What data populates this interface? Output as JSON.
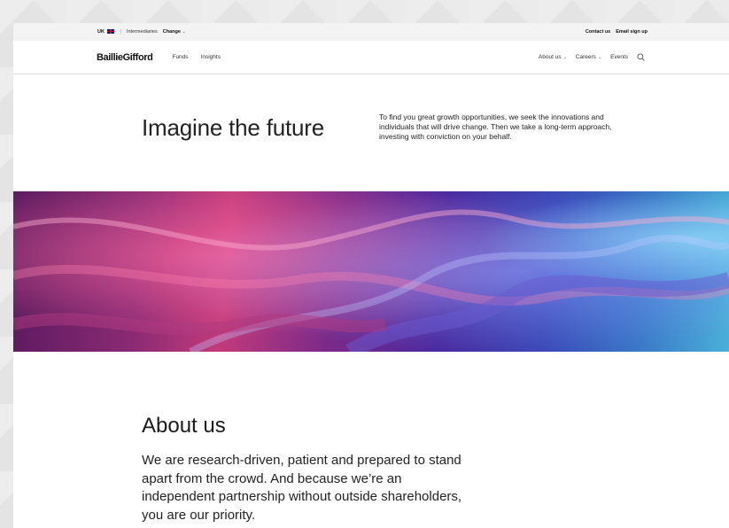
{
  "utility_bar": {
    "region": "UK",
    "region_flag_icon": "uk-flag-icon",
    "separator": "|",
    "audience": "Intermediaries",
    "change_label": "Change",
    "change_icon": "chevron-down-icon",
    "contact_label": "Contact us",
    "email_signup_label": "Email sign up"
  },
  "nav": {
    "logo": "BaillieGifford",
    "left_links": [
      "Funds",
      "Insights"
    ],
    "about_label": "About us",
    "careers_label": "Careers",
    "events_label": "Events",
    "search_icon": "search-icon"
  },
  "hero": {
    "title": "Imagine the future",
    "text": "To find you great growth opportunities, we seek the innovations and individuals that will drive change. Then we take a long-term approach, investing with conviction on your behalf."
  },
  "banner": {
    "description_icon": "abstract-particle-wave-image",
    "colors": [
      "#5a1a5e",
      "#c23a7a",
      "#4a2aa0",
      "#4ab0d8"
    ]
  },
  "about": {
    "heading": "About us",
    "body": "We are research-driven, patient and prepared to stand apart from the crowd. And because we’re an independent partnership without outside shareholders, you are our priority."
  }
}
